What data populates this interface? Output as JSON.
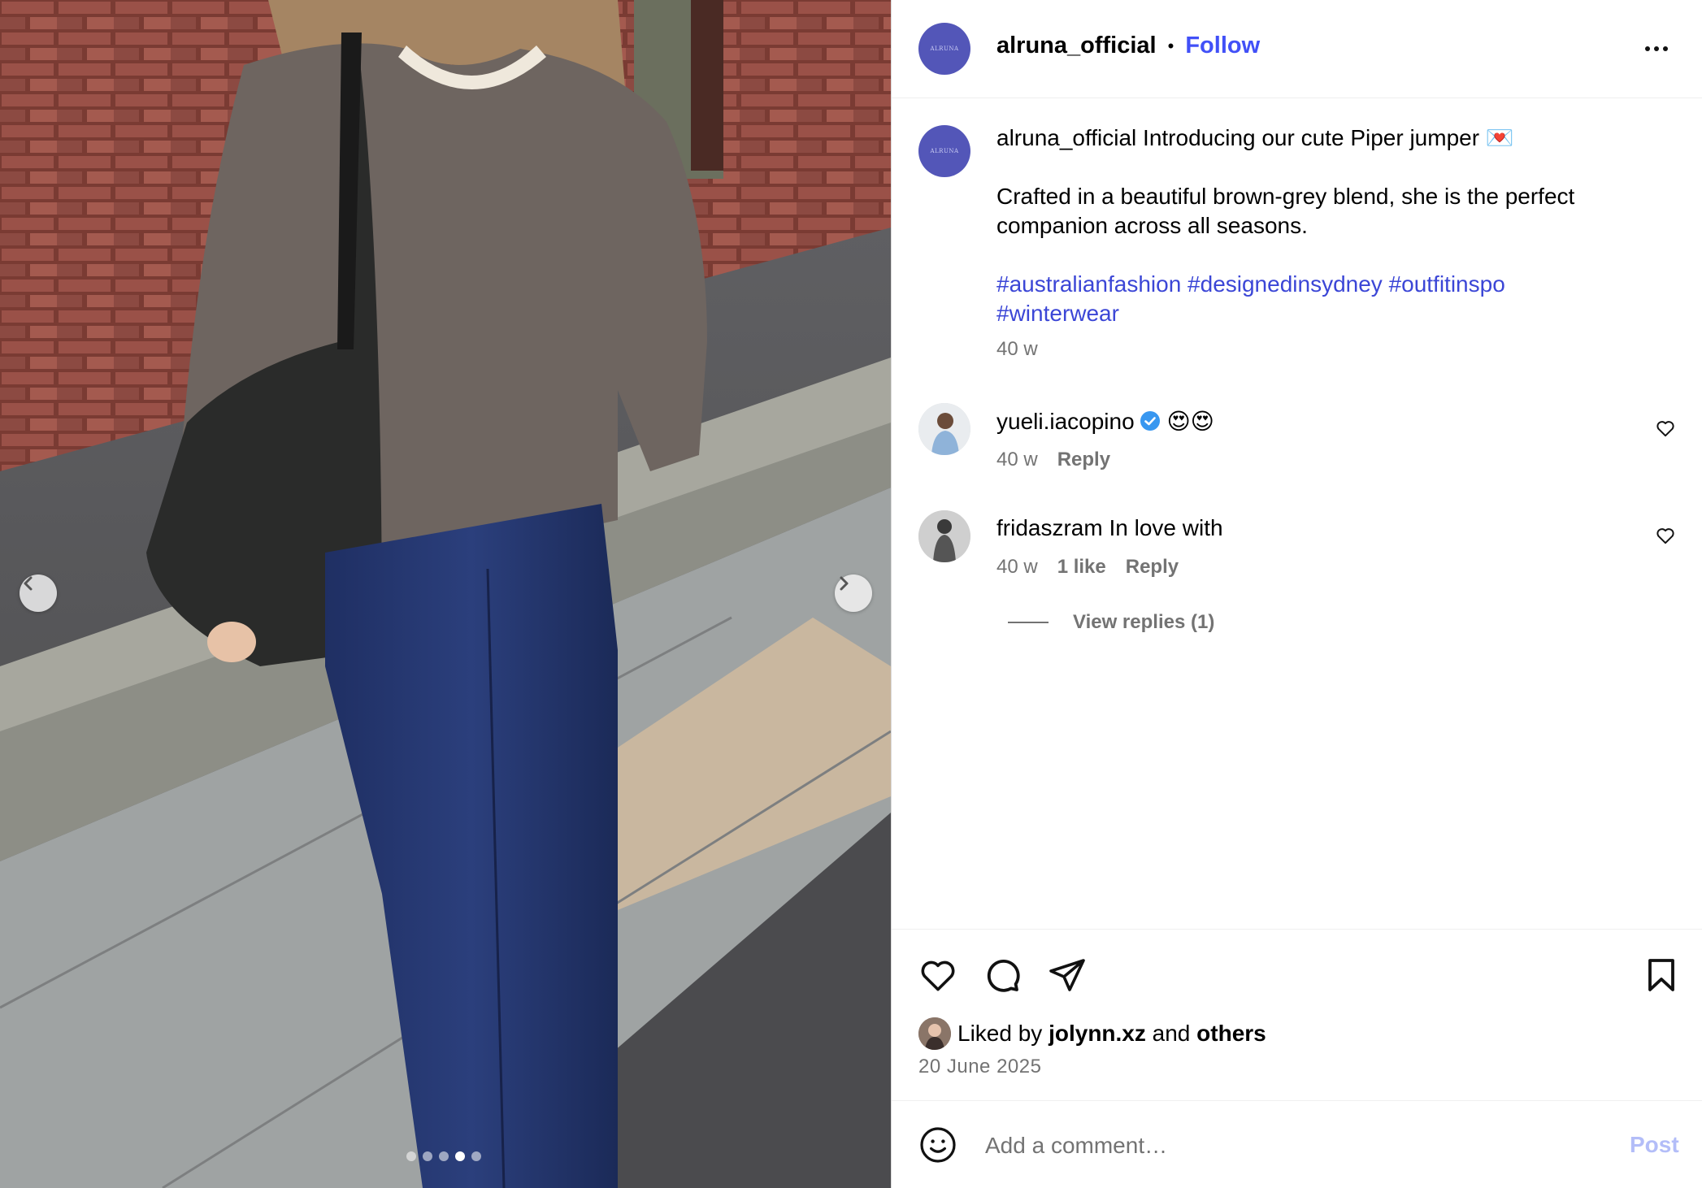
{
  "post": {
    "username": "alruna_official",
    "brand_logo_text": "ALRUNA",
    "bullet": "•",
    "follow_label": "Follow",
    "more_icon": "more-horizontal-icon"
  },
  "caption": {
    "username": "alruna_official",
    "text": "Introducing our cute Piper jumper",
    "emoji": "💌",
    "body": "Crafted in a beautiful brown-grey blend, she is the perfect companion across all seasons.",
    "hashtags_line1": "#australianfashion #designedinsydney #outfitinspo",
    "hashtags_line2": "#winterwear",
    "age": "40 w"
  },
  "comments": [
    {
      "username": "yueli.iacopino",
      "verified": true,
      "text": "😍😍",
      "age": "40 w",
      "likes": "",
      "reply_label": "Reply"
    },
    {
      "username": "fridaszram",
      "verified": false,
      "text": "In love with",
      "age": "40 w",
      "likes": "1 like",
      "reply_label": "Reply",
      "view_replies": "View replies (1)"
    }
  ],
  "actions": {
    "liked_prefix": "Liked by",
    "liked_user": "jolynn.xz",
    "liked_and": "and",
    "liked_others": "others",
    "date": "20 June 2025"
  },
  "composer": {
    "placeholder": "Add a comment…",
    "post_label": "Post"
  },
  "carousel": {
    "total": 5,
    "active_index": 3
  },
  "colors": {
    "accent": "#4150f7",
    "hashtag": "#3b46d6",
    "muted": "#737373",
    "post_disabled": "#b3bdf8",
    "brand": "#5356b8"
  }
}
